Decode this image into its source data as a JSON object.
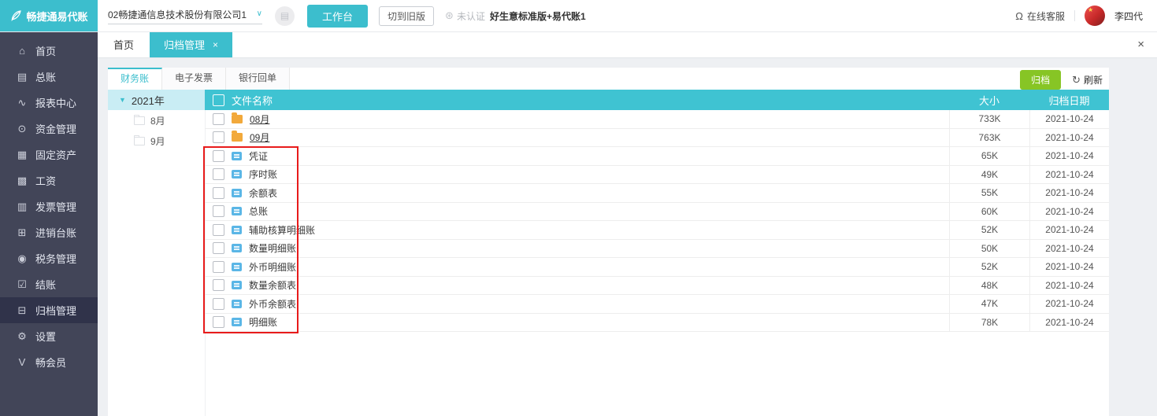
{
  "colors": {
    "brand_cyan": "#3cbecd",
    "table_header_cyan": "#3fc3d2",
    "archive_button_green": "#87c525",
    "annotation_red": "#e81b1b",
    "sidebar_bg": "#424558",
    "sidebar_active_bg": "#30334a",
    "tree_highlight": "#c9edf4",
    "folder_icon_orange": "#f2a93b",
    "file_icon_blue": "#5ab6e6"
  },
  "brand": {
    "logo_text": "畅捷通易代账"
  },
  "topbar": {
    "company_select": "02畅捷通信息技术股份有限公司1",
    "workbench_button": "工作台",
    "switch_old_version_button": "切到旧版",
    "cert_badge": "未认证",
    "edition_text": "好生意标准版+易代账1",
    "online_service": "在线客服",
    "username": "李四代"
  },
  "sidebar": {
    "active": "归档管理",
    "items": [
      {
        "label": "首页",
        "icon": "home-icon"
      },
      {
        "label": "总账",
        "icon": "ledger-icon"
      },
      {
        "label": "报表中心",
        "icon": "report-center-icon"
      },
      {
        "label": "资金管理",
        "icon": "funds-icon"
      },
      {
        "label": "固定资产",
        "icon": "fixed-assets-icon"
      },
      {
        "label": "工资",
        "icon": "salary-icon"
      },
      {
        "label": "发票管理",
        "icon": "invoice-icon"
      },
      {
        "label": "进销台账",
        "icon": "purchase-sales-icon"
      },
      {
        "label": "税务管理",
        "icon": "tax-icon"
      },
      {
        "label": "结账",
        "icon": "closing-icon"
      },
      {
        "label": "归档管理",
        "icon": "archive-icon"
      },
      {
        "label": "设置",
        "icon": "settings-icon"
      },
      {
        "label": "畅会员",
        "icon": "member-icon"
      }
    ]
  },
  "tabs": {
    "active": "归档管理",
    "items": [
      {
        "label": "首页",
        "closable": false
      },
      {
        "label": "归档管理",
        "closable": true
      }
    ]
  },
  "content": {
    "subtabs": [
      "财务账",
      "电子发票",
      "银行回单"
    ],
    "active_subtab": "财务账",
    "archive_button": "归档",
    "refresh_button": "刷新",
    "tree": {
      "year": "2021年",
      "months": [
        "8月",
        "9月"
      ]
    },
    "table": {
      "columns": [
        "文件名称",
        "大小",
        "归档日期"
      ],
      "rows": [
        {
          "name": "08月",
          "type": "folder",
          "size": "733K",
          "date": "2021-10-24"
        },
        {
          "name": "09月",
          "type": "folder",
          "size": "763K",
          "date": "2021-10-24"
        },
        {
          "name": "凭证",
          "type": "file",
          "size": "65K",
          "date": "2021-10-24"
        },
        {
          "name": "序时账",
          "type": "file",
          "size": "49K",
          "date": "2021-10-24"
        },
        {
          "name": "余额表",
          "type": "file",
          "size": "55K",
          "date": "2021-10-24"
        },
        {
          "name": "总账",
          "type": "file",
          "size": "60K",
          "date": "2021-10-24"
        },
        {
          "name": "辅助核算明细账",
          "type": "file",
          "size": "52K",
          "date": "2021-10-24"
        },
        {
          "name": "数量明细账",
          "type": "file",
          "size": "50K",
          "date": "2021-10-24"
        },
        {
          "name": "外币明细账",
          "type": "file",
          "size": "52K",
          "date": "2021-10-24"
        },
        {
          "name": "数量余额表",
          "type": "file",
          "size": "48K",
          "date": "2021-10-24"
        },
        {
          "name": "外币余额表",
          "type": "file",
          "size": "47K",
          "date": "2021-10-24"
        },
        {
          "name": "明细账",
          "type": "file",
          "size": "78K",
          "date": "2021-10-24"
        }
      ]
    }
  },
  "icons": {
    "home-icon": "⌂",
    "ledger-icon": "▤",
    "report-center-icon": "∿",
    "funds-icon": "⊙",
    "fixed-assets-icon": "▦",
    "salary-icon": "▩",
    "invoice-icon": "▥",
    "purchase-sales-icon": "⊞",
    "tax-icon": "◉",
    "closing-icon": "☑",
    "archive-icon": "⊟",
    "settings-icon": "⚙",
    "member-icon": "V",
    "chevron-down-icon": "∨",
    "calendar-icon": "▤",
    "cert-icon": "⊛",
    "headset-icon": "Ω",
    "refresh-icon": "↻",
    "close-icon": "×",
    "tree-expand-icon": "▼",
    "star-icon": "★"
  }
}
